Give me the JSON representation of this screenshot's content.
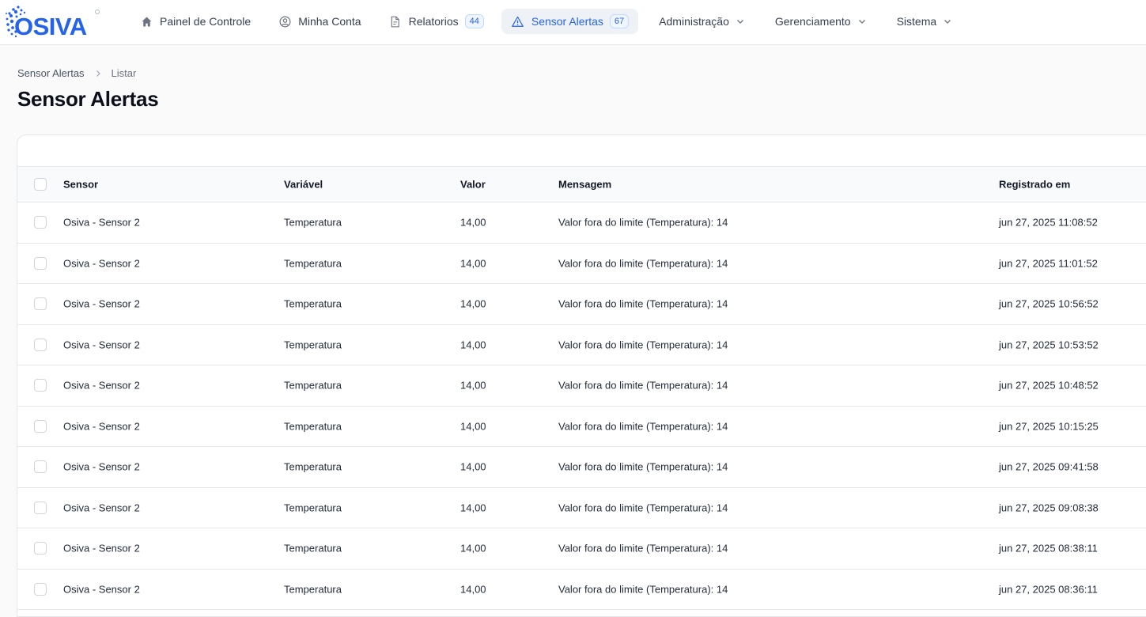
{
  "brand": {
    "logo_text": "OSIVA",
    "accent_color": "#2563eb"
  },
  "nav": {
    "items": [
      {
        "label": "Painel de Controle",
        "icon": "home-icon"
      },
      {
        "label": "Minha Conta",
        "icon": "user-circle-icon"
      },
      {
        "label": "Relatorios",
        "icon": "document-icon",
        "badge": "44"
      },
      {
        "label": "Sensor Alertas",
        "icon": "warning-triangle-icon",
        "badge": "67",
        "active": true
      },
      {
        "label": "Administração",
        "dropdown": true
      },
      {
        "label": "Gerenciamento",
        "dropdown": true
      },
      {
        "label": "Sistema",
        "dropdown": true
      }
    ]
  },
  "breadcrumb": [
    "Sensor Alertas",
    "Listar"
  ],
  "page_title": "Sensor Alertas",
  "table": {
    "columns": [
      "Sensor",
      "Variável",
      "Valor",
      "Mensagem",
      "Registrado em"
    ],
    "rows": [
      [
        "Osiva - Sensor 2",
        "Temperatura",
        "14,00",
        "Valor fora do limite (Temperatura): 14",
        "jun 27, 2025 11:08:52"
      ],
      [
        "Osiva - Sensor 2",
        "Temperatura",
        "14,00",
        "Valor fora do limite (Temperatura): 14",
        "jun 27, 2025 11:01:52"
      ],
      [
        "Osiva - Sensor 2",
        "Temperatura",
        "14,00",
        "Valor fora do limite (Temperatura): 14",
        "jun 27, 2025 10:56:52"
      ],
      [
        "Osiva - Sensor 2",
        "Temperatura",
        "14,00",
        "Valor fora do limite (Temperatura): 14",
        "jun 27, 2025 10:53:52"
      ],
      [
        "Osiva - Sensor 2",
        "Temperatura",
        "14,00",
        "Valor fora do limite (Temperatura): 14",
        "jun 27, 2025 10:48:52"
      ],
      [
        "Osiva - Sensor 2",
        "Temperatura",
        "14,00",
        "Valor fora do limite (Temperatura): 14",
        "jun 27, 2025 10:15:25"
      ],
      [
        "Osiva - Sensor 2",
        "Temperatura",
        "14,00",
        "Valor fora do limite (Temperatura): 14",
        "jun 27, 2025 09:41:58"
      ],
      [
        "Osiva - Sensor 2",
        "Temperatura",
        "14,00",
        "Valor fora do limite (Temperatura): 14",
        "jun 27, 2025 09:08:38"
      ],
      [
        "Osiva - Sensor 2",
        "Temperatura",
        "14,00",
        "Valor fora do limite (Temperatura): 14",
        "jun 27, 2025 08:38:11"
      ],
      [
        "Osiva - Sensor 2",
        "Temperatura",
        "14,00",
        "Valor fora do limite (Temperatura): 14",
        "jun 27, 2025 08:36:11"
      ]
    ]
  }
}
